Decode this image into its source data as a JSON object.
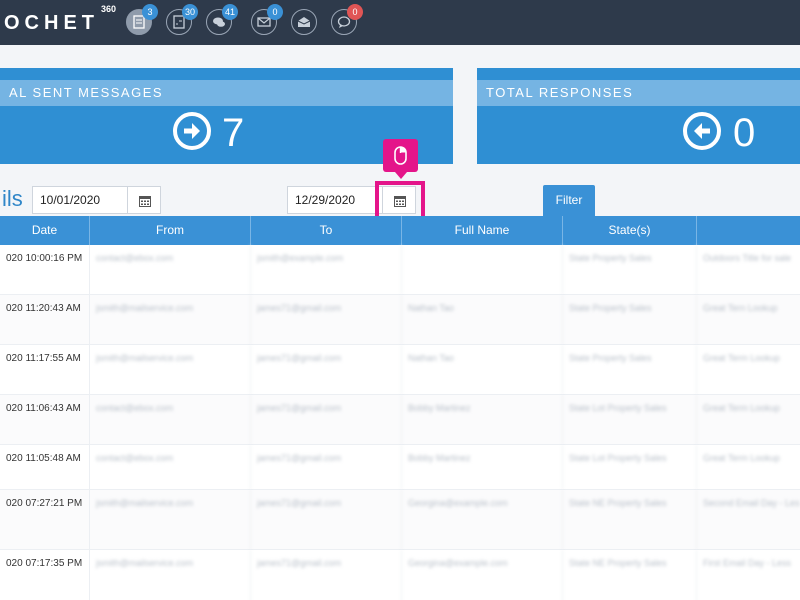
{
  "header": {
    "logo_text": "OCHET",
    "logo_sup": "360",
    "nav": [
      {
        "icon": "document-icon",
        "badge": "3",
        "active": true
      },
      {
        "icon": "report-icon",
        "badge": "30"
      },
      {
        "icon": "chat-icon",
        "badge": "41"
      },
      {
        "icon": "mail-icon",
        "badge": "0"
      },
      {
        "icon": "open-mail-icon",
        "badge": ""
      },
      {
        "icon": "comment-icon",
        "badge": "0",
        "badge_color": "red"
      }
    ]
  },
  "cards": {
    "sent": {
      "title": "AL SENT MESSAGES",
      "value": "7"
    },
    "responses": {
      "title": "TOTAL RESPONSES",
      "value": "0"
    }
  },
  "filters": {
    "section_title": "ils",
    "start_date": "10/01/2020",
    "end_date": "12/29/2020",
    "filter_label": "Filter"
  },
  "table": {
    "headers": [
      "Date",
      "From",
      "To",
      "Full Name",
      "State(s)",
      ""
    ],
    "rows": [
      {
        "date": "020 10:00:16 PM",
        "from": "contact@ebox.com",
        "to": "jsmith@example.com",
        "name": "",
        "state": "State Property Sales",
        "extra": "Outdoors Title for sale"
      },
      {
        "date": "020 11:20:43 AM",
        "from": "jsmith@mailservice.com",
        "to": "james71@gmail.com",
        "name": "Nathan Tao",
        "state": "State Property Sales",
        "extra": "Great Tern Lookup"
      },
      {
        "date": "020 11:17:55 AM",
        "from": "jsmith@mailservice.com",
        "to": "james71@gmail.com",
        "name": "Nathan Tao",
        "state": "State Property Sales",
        "extra": "Great Term Lookup"
      },
      {
        "date": "020 11:06:43 AM",
        "from": "contact@ebox.com",
        "to": "james71@gmail.com",
        "name": "Bobby Martinez",
        "state": "State Lot Property Sales",
        "extra": "Great Term Lookup"
      },
      {
        "date": "020 11:05:48 AM",
        "from": "contact@ebox.com",
        "to": "james71@gmail.com",
        "name": "Bobby Martinez",
        "state": "State Lot Property Sales",
        "extra": "Great Term Lookup"
      },
      {
        "date": "020 07:27:21 PM",
        "from": "jsmith@mailservice.com",
        "to": "james71@gmail.com",
        "name": "Georgina@example.com",
        "state": "State NE Property Sales",
        "extra": "Second Email Day - Less"
      },
      {
        "date": "020 07:17:35 PM",
        "from": "jsmith@mailservice.com",
        "to": "james71@gmail.com",
        "name": "Georgina@example.com",
        "state": "State NE Property Sales",
        "extra": "First Email Day - Less"
      }
    ]
  }
}
